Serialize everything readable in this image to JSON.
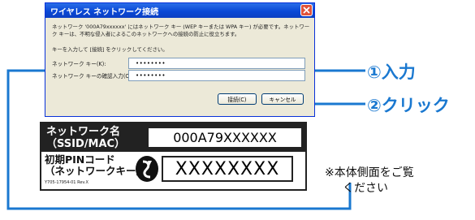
{
  "dialog": {
    "title": "ワイヤレス ネットワーク接続",
    "message": "ネットワーク '000A79xxxxxx' にはネットワーク キー (WEP キーまたは WPA キー) が必要です。ネットワーク キーは、不明な侵入者によるこのネットワークへの接続の防止に役立ちます。",
    "instruction": "キーを入力して [接続] をクリックしてください。",
    "key_label": "ネットワーク キー(K):",
    "key_value": "••••••••",
    "confirm_label": "ネットワーク キーの確認入力(O):",
    "confirm_value": "••••••••",
    "connect_button": "接続(C)",
    "cancel_button": "キャンセル"
  },
  "annotations": {
    "input": "①入力",
    "click": "②クリック"
  },
  "label_card": {
    "ssid_label_line1": "ネットワーク名",
    "ssid_label_line2": "（SSID/MAC）",
    "ssid_value": "000A79XXXXXX",
    "pin_label_line1": "初期PINコード",
    "pin_label_line2": "（ネットワークキー）",
    "pin_value": "XXXXXXXX",
    "revision": "Y705-17954-01 Rev.X"
  },
  "note": {
    "line1": "※本体側面をご覧",
    "line2": "ください"
  },
  "colors": {
    "accent": "#1a78d0",
    "titlebar": "#0a48d6",
    "close": "#e0533a"
  }
}
